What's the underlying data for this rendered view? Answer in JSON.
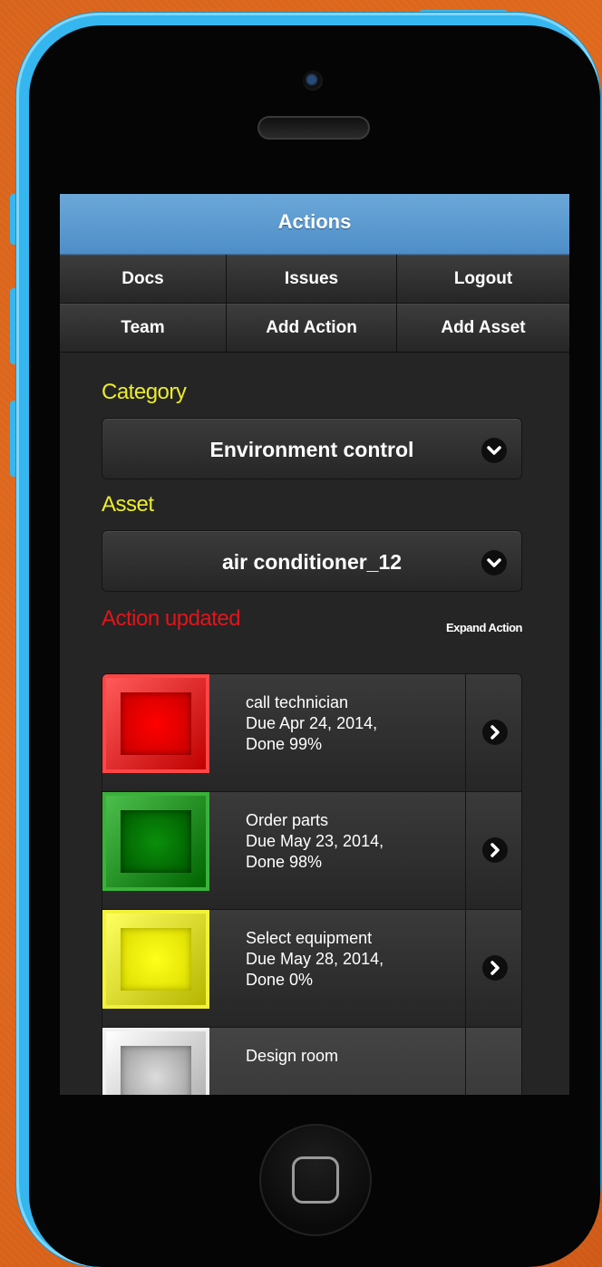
{
  "header": {
    "title": "Actions"
  },
  "nav": [
    {
      "label": "Docs"
    },
    {
      "label": "Issues"
    },
    {
      "label": "Logout"
    },
    {
      "label": "Team"
    },
    {
      "label": "Add Action"
    },
    {
      "label": "Add Asset"
    }
  ],
  "category": {
    "label": "Category",
    "value": "Environment control"
  },
  "asset": {
    "label": "Asset",
    "value": "air conditioner_12"
  },
  "status": {
    "message": "Action updated",
    "expand_label": "Expand Action"
  },
  "actions": [
    {
      "title": "call technician",
      "due": "Due Apr 24, 2014,",
      "done": "Done 99%",
      "color": "#e30000"
    },
    {
      "title": "Order parts",
      "due": "Due May 23, 2014,",
      "done": "Done 98%",
      "color": "#0a8a0a"
    },
    {
      "title": "Select equipment",
      "due": "Due May 28, 2014,",
      "done": "Done 0%",
      "color": "#e8e800"
    },
    {
      "title": "Design room",
      "due": "",
      "done": "",
      "color": "#e0e0e0"
    }
  ]
}
